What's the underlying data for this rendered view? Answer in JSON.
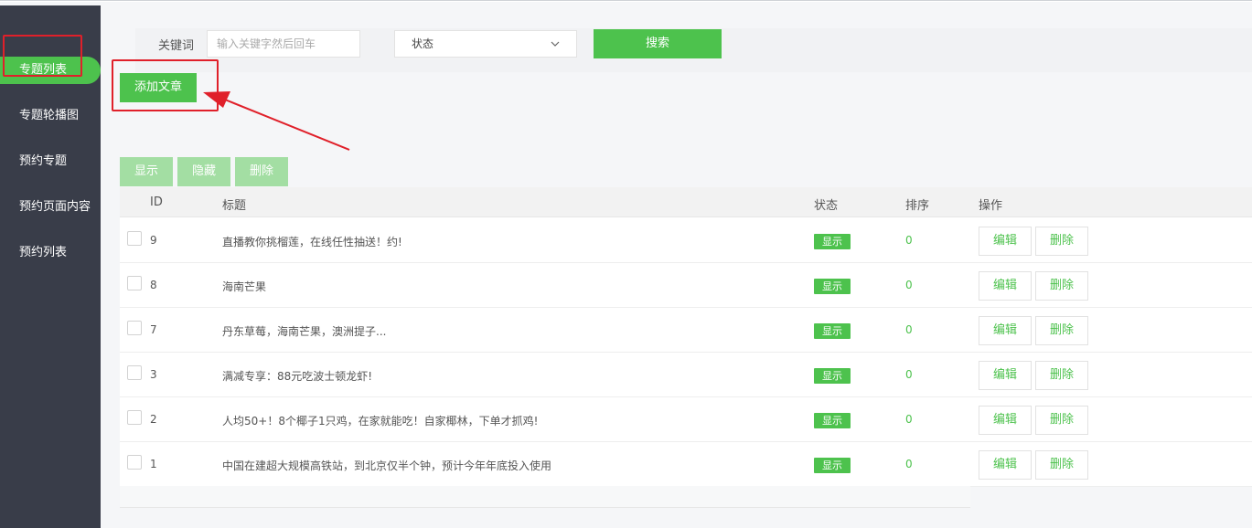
{
  "sidebar": {
    "items": [
      {
        "label": "专题列表",
        "active": true
      },
      {
        "label": "专题轮播图",
        "active": false
      },
      {
        "label": "预约专题",
        "active": false
      },
      {
        "label": "预约页面内容",
        "active": false
      },
      {
        "label": "预约列表",
        "active": false
      }
    ]
  },
  "search": {
    "keyword_label": "关键词",
    "keyword_placeholder": "输入关键字然后回车",
    "keyword_value": "",
    "status_selected": "状态",
    "search_label": "搜索"
  },
  "toolbar": {
    "add_label": "添加文章",
    "show_label": "显示",
    "hide_label": "隐藏",
    "delete_label": "删除"
  },
  "table": {
    "columns": [
      "ID",
      "标题",
      "状态",
      "排序",
      "操作"
    ],
    "rows": [
      {
        "id": "9",
        "title": "直播教你挑榴莲，在线任性抽送！约!",
        "status": "显示",
        "order": "0",
        "edit": "编辑",
        "delete": "删除"
      },
      {
        "id": "8",
        "title": "海南芒果",
        "status": "显示",
        "order": "0",
        "edit": "编辑",
        "delete": "删除"
      },
      {
        "id": "7",
        "title": "丹东草莓，海南芒果，澳洲提子...",
        "status": "显示",
        "order": "0",
        "edit": "编辑",
        "delete": "删除"
      },
      {
        "id": "3",
        "title": "满减专享：88元吃波士顿龙虾!",
        "status": "显示",
        "order": "0",
        "edit": "编辑",
        "delete": "删除"
      },
      {
        "id": "2",
        "title": "人均50+！8个椰子1只鸡，在家就能吃！自家椰林，下单才抓鸡!",
        "status": "显示",
        "order": "0",
        "edit": "编辑",
        "delete": "删除"
      },
      {
        "id": "1",
        "title": "中国在建超大规模高铁站，到北京仅半个钟，预计今年年底投入使用",
        "status": "显示",
        "order": "0",
        "edit": "编辑",
        "delete": "删除"
      }
    ]
  },
  "colors": {
    "accent": "#4dc24d",
    "accent_light": "#a3dea3",
    "sidebar_bg": "#393d49",
    "annotation": "#e0202a"
  },
  "icons": {
    "select_arrow": "chevron-down-icon"
  }
}
